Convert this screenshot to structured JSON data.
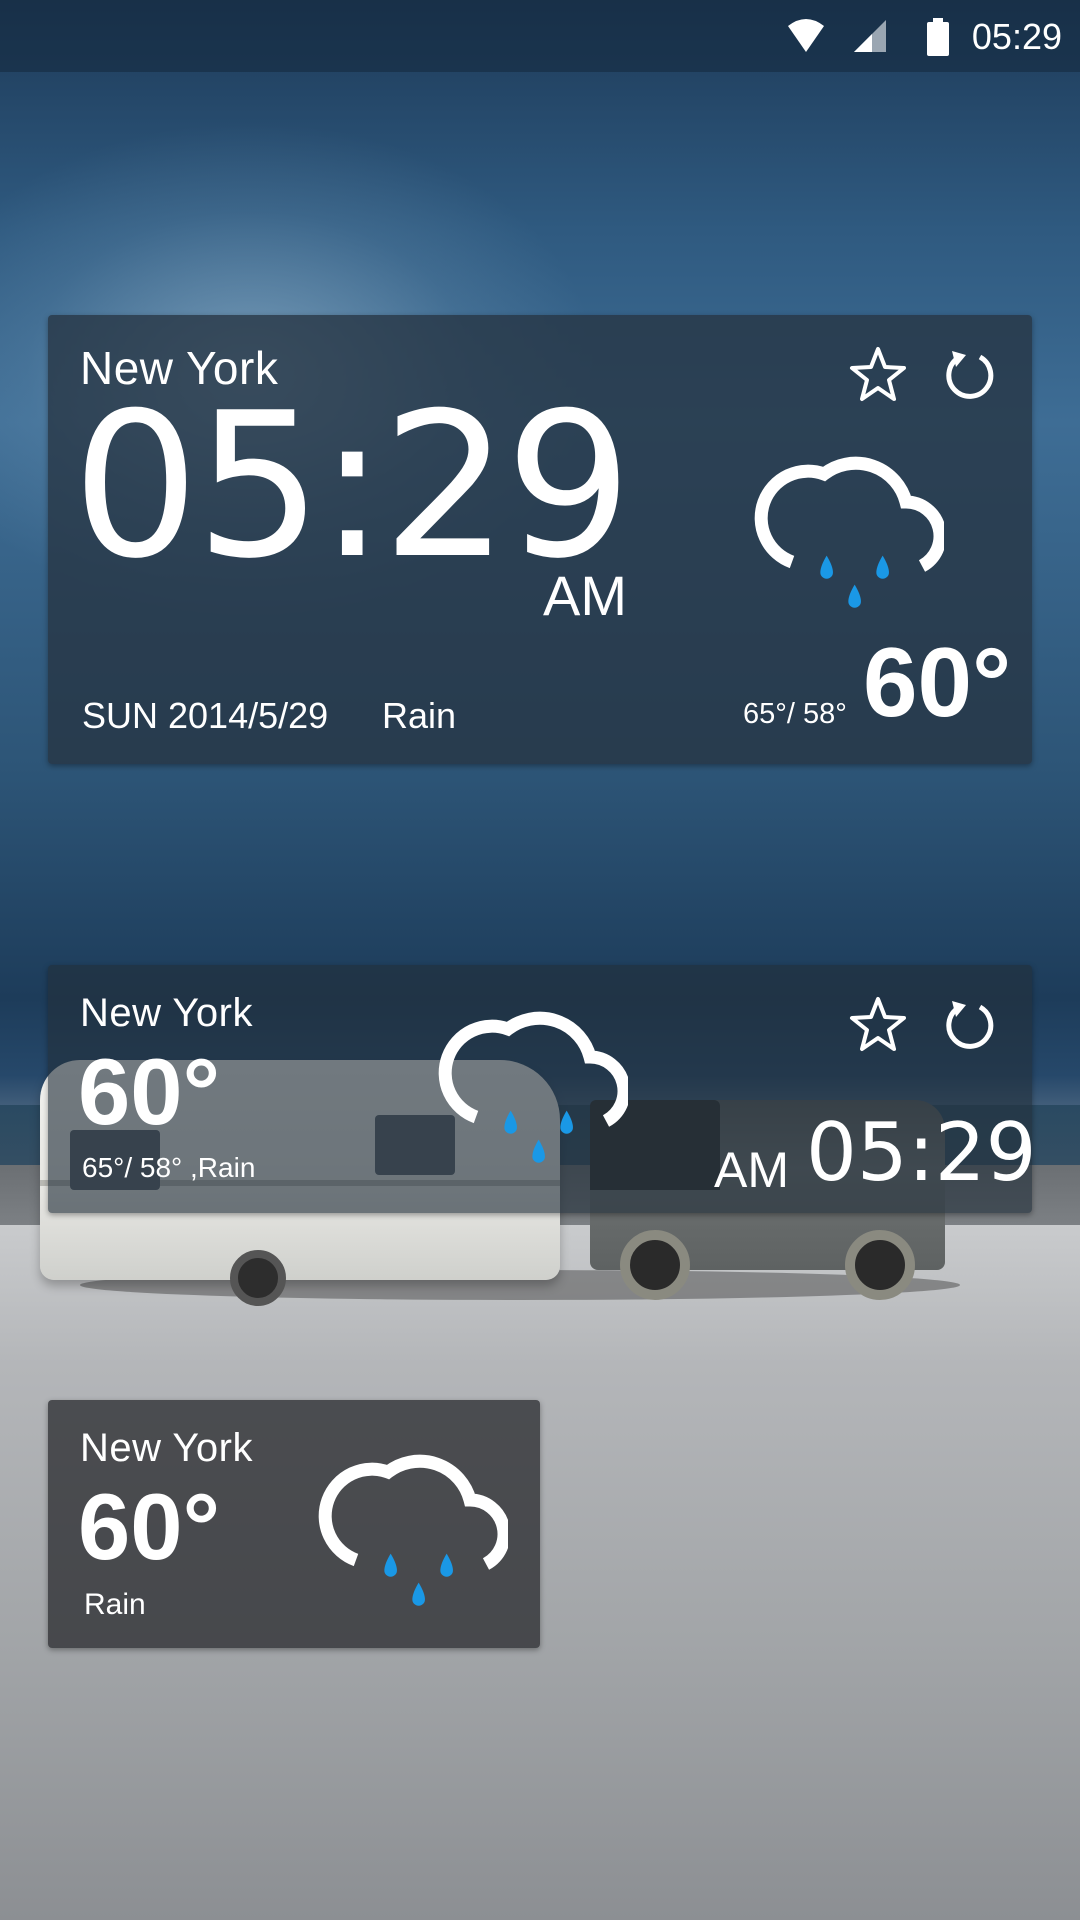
{
  "status_bar": {
    "time": "05:29",
    "icons": [
      "wifi-icon",
      "signal-icon",
      "battery-icon"
    ]
  },
  "widget_large": {
    "city": "New York",
    "clock": "05:29",
    "ampm": "AM",
    "date": "SUN 2014/5/29",
    "condition": "Rain",
    "hi_lo": "65°/ 58°",
    "temperature": "60°",
    "icons": [
      "star-icon",
      "refresh-icon",
      "rain-cloud-icon"
    ]
  },
  "widget_medium": {
    "city": "New York",
    "temperature": "60°",
    "hi_lo_condition": "65°/ 58° ,Rain",
    "ampm": "AM",
    "clock": "05:29",
    "icons": [
      "star-icon",
      "refresh-icon",
      "rain-cloud-icon"
    ]
  },
  "widget_small": {
    "city": "New York",
    "temperature": "60°",
    "condition": "Rain",
    "icons": [
      "rain-cloud-icon"
    ]
  },
  "colors": {
    "raindrop": "#1a98e6",
    "text": "#ffffff"
  }
}
